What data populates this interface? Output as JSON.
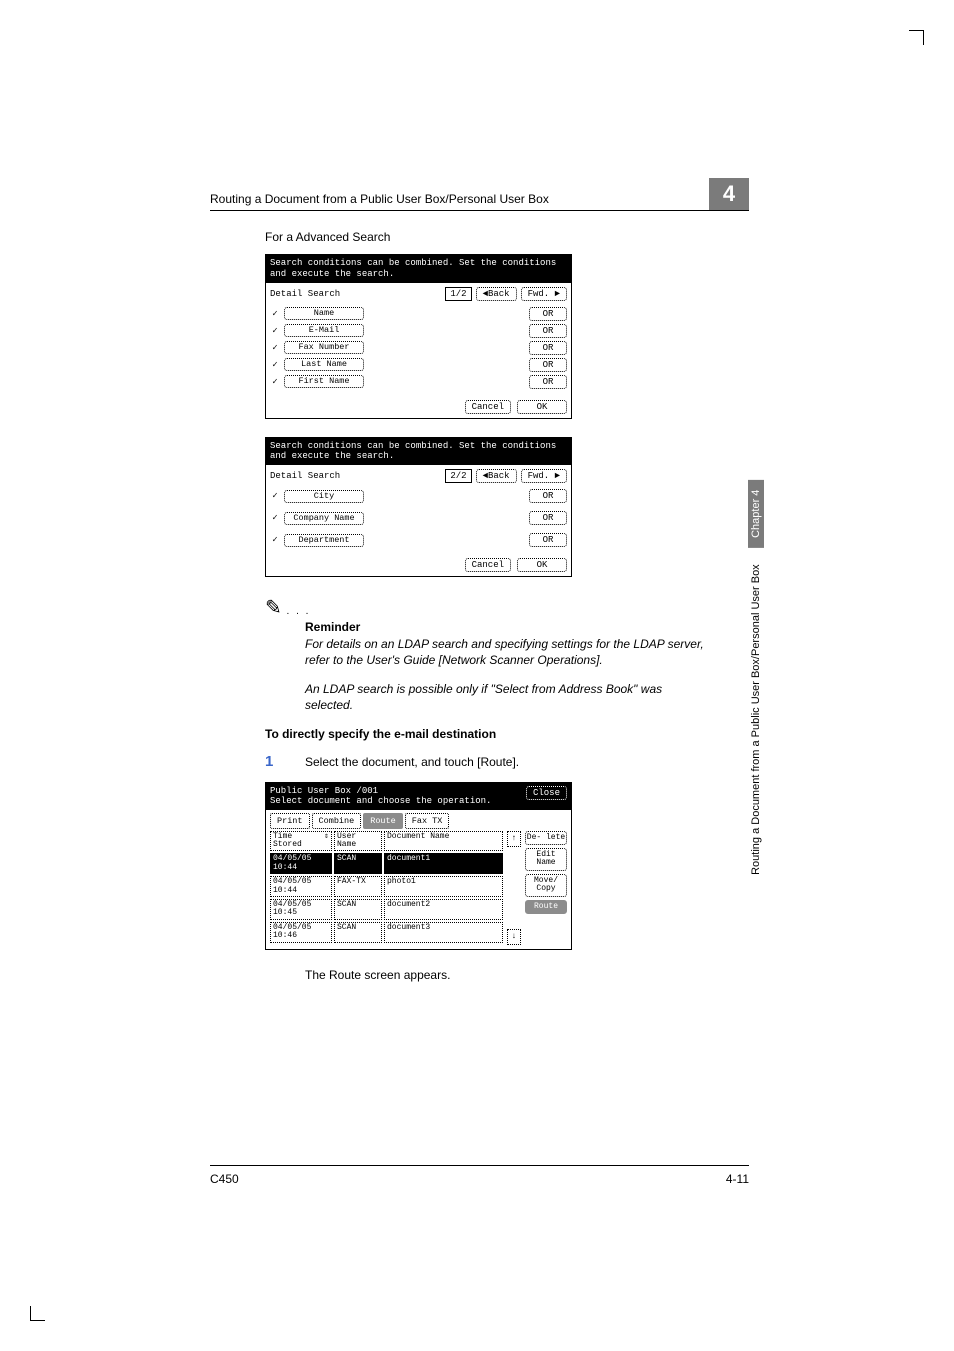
{
  "header": {
    "running_title": "Routing a Document from a Public User Box/Personal User Box",
    "chapter_number": "4"
  },
  "caption": "For a Advanced Search",
  "panel1": {
    "instruction": "Search conditions can be combined. Set the conditions and execute the search.",
    "title": "Detail Search",
    "page": "1/2",
    "back": "Back",
    "fwd": "Fwd.",
    "or": "OR",
    "cancel": "Cancel",
    "ok": "OK",
    "rows": [
      "Name",
      "E-Mail",
      "Fax Number",
      "Last Name",
      "First Name"
    ]
  },
  "panel2": {
    "instruction": "Search conditions can be combined. Set the conditions and execute the search.",
    "title": "Detail Search",
    "page": "2/2",
    "back": "Back",
    "fwd": "Fwd.",
    "or": "OR",
    "cancel": "Cancel",
    "ok": "OK",
    "rows": [
      "City",
      "Company Name",
      "Department"
    ]
  },
  "reminder": {
    "heading": "Reminder",
    "body1": "For details on an LDAP search and specifying settings for the LDAP server, refer to the User's Guide [Network Scanner Operations].",
    "body2": "An LDAP search is possible only if \"Select from Address Book\" was selected."
  },
  "section_heading": "To directly specify the e-mail destination",
  "step1": {
    "num": "1",
    "text": "Select the document, and touch [Route]."
  },
  "route_panel": {
    "box_title": "Public User Box  /001",
    "prompt": "Select document and choose the operation.",
    "close": "Close",
    "tabs": [
      "Print",
      "Combine",
      "Route",
      "Fax TX"
    ],
    "header": {
      "time": "Time Stored",
      "sort": "⇕",
      "user": "User Name",
      "doc": "Document Name"
    },
    "rows": [
      {
        "ts": "04/05/05 10:44",
        "un": "SCAN",
        "dn": "document1"
      },
      {
        "ts": "04/05/05 10:44",
        "un": "FAX-TX",
        "dn": "photo1"
      },
      {
        "ts": "04/05/05 10:45",
        "un": "SCAN",
        "dn": "document2"
      },
      {
        "ts": "04/05/05 10:46",
        "un": "SCAN",
        "dn": "document3"
      }
    ],
    "arrows": {
      "up": "↑",
      "down": "↓"
    },
    "side": [
      "De- lete",
      "Edit Name",
      "Move/ Copy",
      "Route"
    ]
  },
  "result_text": "The Route screen appears.",
  "side_tab": {
    "long": "Routing a Document from a Public User Box/Personal User Box",
    "short": "Chapter 4"
  },
  "footer": {
    "model": "C450",
    "page": "4-11"
  }
}
